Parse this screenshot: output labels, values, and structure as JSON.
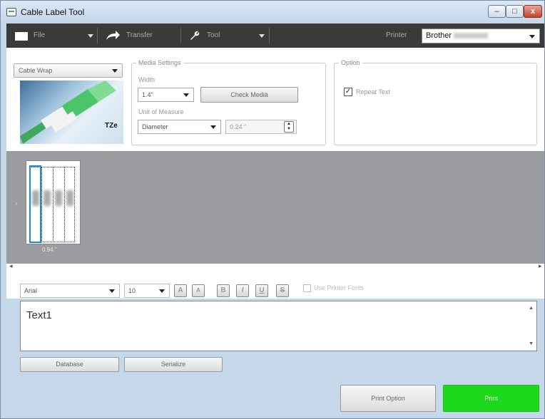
{
  "window": {
    "title": "Cable Label Tool",
    "min": "–",
    "max": "□",
    "close": "x"
  },
  "toolbar": {
    "file": "File",
    "transfer": "Transfer",
    "tool": "Tool",
    "printer_label": "Printer",
    "printer_value": "Brother"
  },
  "app": {
    "selected": "Cable Wrap",
    "tze": "TZe"
  },
  "media": {
    "legend": "Media Settings",
    "width_label": "Width",
    "width_value": "1.4\"",
    "check_media": "Check Media",
    "unit_label": "Unit of Measure",
    "unit_value": "Diameter",
    "measure_value": "0.24 \""
  },
  "option": {
    "legend": "Option",
    "repeat_text": "Repeat Text",
    "repeat_checked": true
  },
  "preview": {
    "size_caption": "0.94 \""
  },
  "format": {
    "font": "Arial",
    "size": "10",
    "use_printer_fonts": "Use Printer Fonts",
    "buttons": [
      "A",
      "A",
      "B",
      "I",
      "U",
      "S"
    ]
  },
  "text": {
    "value": "Text1"
  },
  "actions": {
    "database": "Database",
    "serialize": "Serialize",
    "print_option": "Print Option",
    "print": "Print"
  },
  "colors": {
    "toolbar": "#3a3a3a",
    "preview_bg": "#9a9ca0",
    "print": "#1ed81e",
    "selection": "#1b8de0"
  }
}
